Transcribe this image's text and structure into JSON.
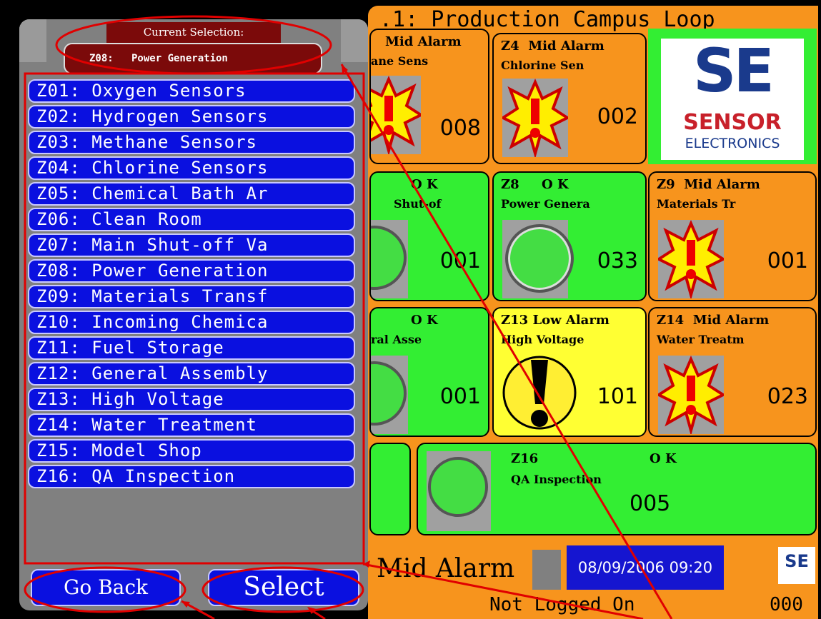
{
  "hmi": {
    "title": ".1: Production Campus Loop",
    "tiles": {
      "z3": {
        "head": "Mid Alarm",
        "name": "ane Sens",
        "count": "008"
      },
      "z4": {
        "head": "Z4  Mid Alarm",
        "name": "Chlorine Sen",
        "count": "002"
      },
      "z7": {
        "head": "O K",
        "name": "Shut-of",
        "count": "001"
      },
      "z8": {
        "head": "Z8     O K",
        "name": "Power Genera",
        "count": "033"
      },
      "z9": {
        "head": "Z9  Mid Alarm",
        "name": "Materials Tr",
        "count": "001"
      },
      "z12": {
        "head": "O K",
        "name": "ral Asse",
        "count": "001"
      },
      "z13": {
        "head": "Z13 Low Alarm",
        "name": "High Voltage",
        "count": "101"
      },
      "z14": {
        "head": "Z14  Mid Alarm",
        "name": "Water Treatm",
        "count": "023"
      },
      "z16": {
        "head": "Z16",
        "status": "O K",
        "name": "QA Inspection",
        "count": "005"
      }
    },
    "logo": {
      "se": "SE",
      "sensor": "SENSOR",
      "electronics": "ELECTRONICS"
    },
    "status": {
      "alarm": "Mid Alarm",
      "datetime": "08/09/2006 09:20",
      "logo": "SE",
      "login": "Not Logged On",
      "code": "000"
    }
  },
  "panel": {
    "current_label": "Current Selection:",
    "current_value": "Z08:   Power Generation",
    "zones": [
      "Z01: Oxygen Sensors",
      "Z02: Hydrogen Sensors",
      "Z03: Methane Sensors",
      "Z04: Chlorine Sensors",
      "Z05: Chemical Bath Ar",
      "Z06: Clean Room",
      "Z07: Main Shut-off Va",
      "Z08: Power Generation",
      "Z09: Materials Transf",
      "Z10: Incoming Chemica",
      "Z11: Fuel Storage",
      "Z12: General Assembly",
      "Z13: High Voltage",
      "Z14: Water Treatment",
      "Z15: Model Shop",
      "Z16: QA Inspection"
    ],
    "go_back": "Go Back",
    "select": "Select"
  },
  "colors": {
    "annotation": "#e00000",
    "list_button": "#0a10e0",
    "selection_bg": "#7b0a0a",
    "alarm_orange": "#f7941d",
    "ok_green": "#33ee33",
    "low_yellow": "#ffff33"
  },
  "icons": {
    "mid_alarm": "alarm-burst-icon",
    "ok": "green-circle-icon",
    "low_alarm": "exclamation-circle-icon"
  }
}
